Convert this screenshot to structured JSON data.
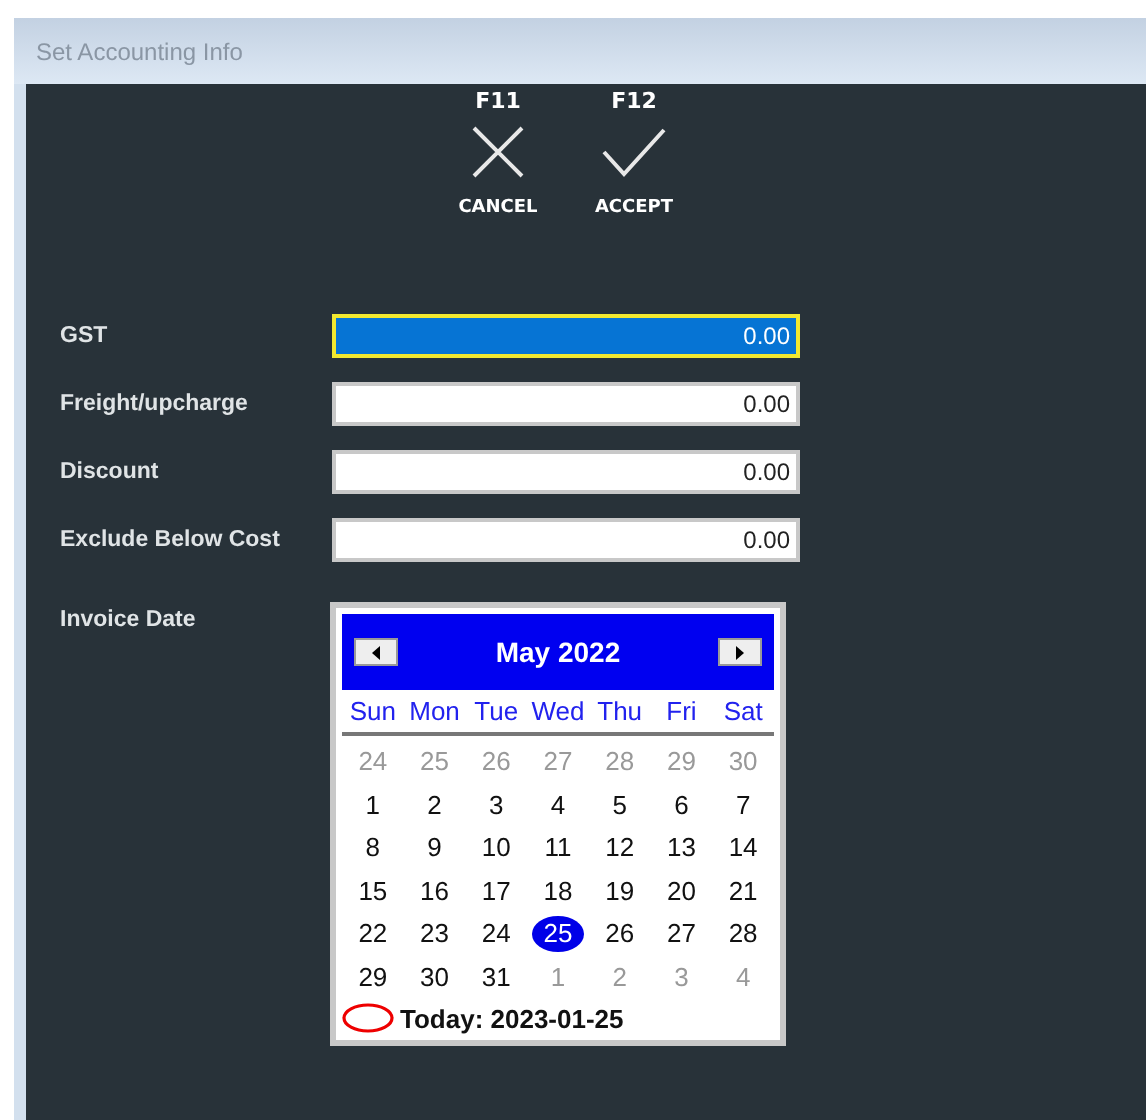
{
  "window": {
    "title": "Set Accounting Info"
  },
  "actions": [
    {
      "key": "F11",
      "kind": "cancel",
      "label": "CANCEL"
    },
    {
      "key": "F12",
      "kind": "accept",
      "label": "ACCEPT"
    }
  ],
  "fields": [
    {
      "label": "GST",
      "value": "0.00",
      "focused": true
    },
    {
      "label": "Freight/upcharge",
      "value": "0.00",
      "focused": false
    },
    {
      "label": "Discount",
      "value": "0.00",
      "focused": false
    },
    {
      "label": "Exclude Below Cost",
      "value": "0.00",
      "focused": false
    }
  ],
  "invoice_date": {
    "label": "Invoice Date",
    "calendar": {
      "month": "May 2022",
      "weekdays": [
        "Sun",
        "Mon",
        "Tue",
        "Wed",
        "Thu",
        "Fri",
        "Sat"
      ],
      "weeks": [
        [
          {
            "day": "24",
            "outside": true,
            "selected": false
          },
          {
            "day": "25",
            "outside": true,
            "selected": false
          },
          {
            "day": "26",
            "outside": true,
            "selected": false
          },
          {
            "day": "27",
            "outside": true,
            "selected": false
          },
          {
            "day": "28",
            "outside": true,
            "selected": false
          },
          {
            "day": "29",
            "outside": true,
            "selected": false
          },
          {
            "day": "30",
            "outside": true,
            "selected": false
          }
        ],
        [
          {
            "day": "1",
            "outside": false,
            "selected": false
          },
          {
            "day": "2",
            "outside": false,
            "selected": false
          },
          {
            "day": "3",
            "outside": false,
            "selected": false
          },
          {
            "day": "4",
            "outside": false,
            "selected": false
          },
          {
            "day": "5",
            "outside": false,
            "selected": false
          },
          {
            "day": "6",
            "outside": false,
            "selected": false
          },
          {
            "day": "7",
            "outside": false,
            "selected": false
          }
        ],
        [
          {
            "day": "8",
            "outside": false,
            "selected": false
          },
          {
            "day": "9",
            "outside": false,
            "selected": false
          },
          {
            "day": "10",
            "outside": false,
            "selected": false
          },
          {
            "day": "11",
            "outside": false,
            "selected": false
          },
          {
            "day": "12",
            "outside": false,
            "selected": false
          },
          {
            "day": "13",
            "outside": false,
            "selected": false
          },
          {
            "day": "14",
            "outside": false,
            "selected": false
          }
        ],
        [
          {
            "day": "15",
            "outside": false,
            "selected": false
          },
          {
            "day": "16",
            "outside": false,
            "selected": false
          },
          {
            "day": "17",
            "outside": false,
            "selected": false
          },
          {
            "day": "18",
            "outside": false,
            "selected": false
          },
          {
            "day": "19",
            "outside": false,
            "selected": false
          },
          {
            "day": "20",
            "outside": false,
            "selected": false
          },
          {
            "day": "21",
            "outside": false,
            "selected": false
          }
        ],
        [
          {
            "day": "22",
            "outside": false,
            "selected": false
          },
          {
            "day": "23",
            "outside": false,
            "selected": false
          },
          {
            "day": "24",
            "outside": false,
            "selected": false
          },
          {
            "day": "25",
            "outside": false,
            "selected": true
          },
          {
            "day": "26",
            "outside": false,
            "selected": false
          },
          {
            "day": "27",
            "outside": false,
            "selected": false
          },
          {
            "day": "28",
            "outside": false,
            "selected": false
          }
        ],
        [
          {
            "day": "29",
            "outside": false,
            "selected": false
          },
          {
            "day": "30",
            "outside": false,
            "selected": false
          },
          {
            "day": "31",
            "outside": false,
            "selected": false
          },
          {
            "day": "1",
            "outside": true,
            "selected": false
          },
          {
            "day": "2",
            "outside": true,
            "selected": false
          },
          {
            "day": "3",
            "outside": true,
            "selected": false
          },
          {
            "day": "4",
            "outside": true,
            "selected": false
          }
        ]
      ],
      "today": "Today: 2023-01-25"
    }
  }
}
